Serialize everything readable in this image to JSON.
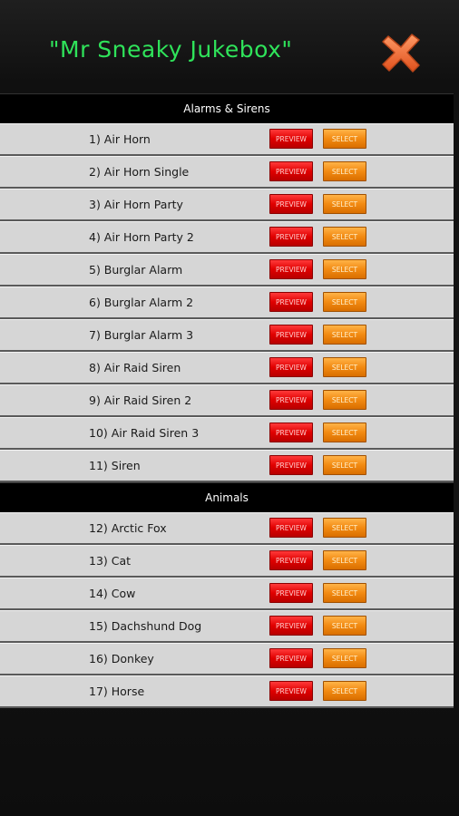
{
  "header": {
    "title": "\"Mr Sneaky Jukebox\""
  },
  "colors": {
    "title": "#2fe35a",
    "close_icon": "#f26a2e",
    "preview": "#e00000",
    "select": "#f28a12"
  },
  "icons": {
    "close": "close-x-icon"
  },
  "buttons": {
    "preview_label": "PREVIEW",
    "select_label": "SELECT"
  },
  "sections": [
    {
      "title": "Alarms & Sirens",
      "items": [
        "1) Air Horn",
        "2) Air Horn Single",
        "3) Air Horn Party",
        "4) Air Horn Party 2",
        "5) Burglar Alarm",
        "6) Burglar Alarm 2",
        "7) Burglar Alarm 3",
        "8) Air Raid Siren",
        "9) Air Raid Siren 2",
        "10) Air Raid Siren 3",
        "11) Siren"
      ]
    },
    {
      "title": "Animals",
      "items": [
        "12) Arctic Fox",
        "13) Cat",
        "14) Cow",
        "15) Dachshund Dog",
        "16) Donkey",
        "17) Horse"
      ]
    }
  ]
}
